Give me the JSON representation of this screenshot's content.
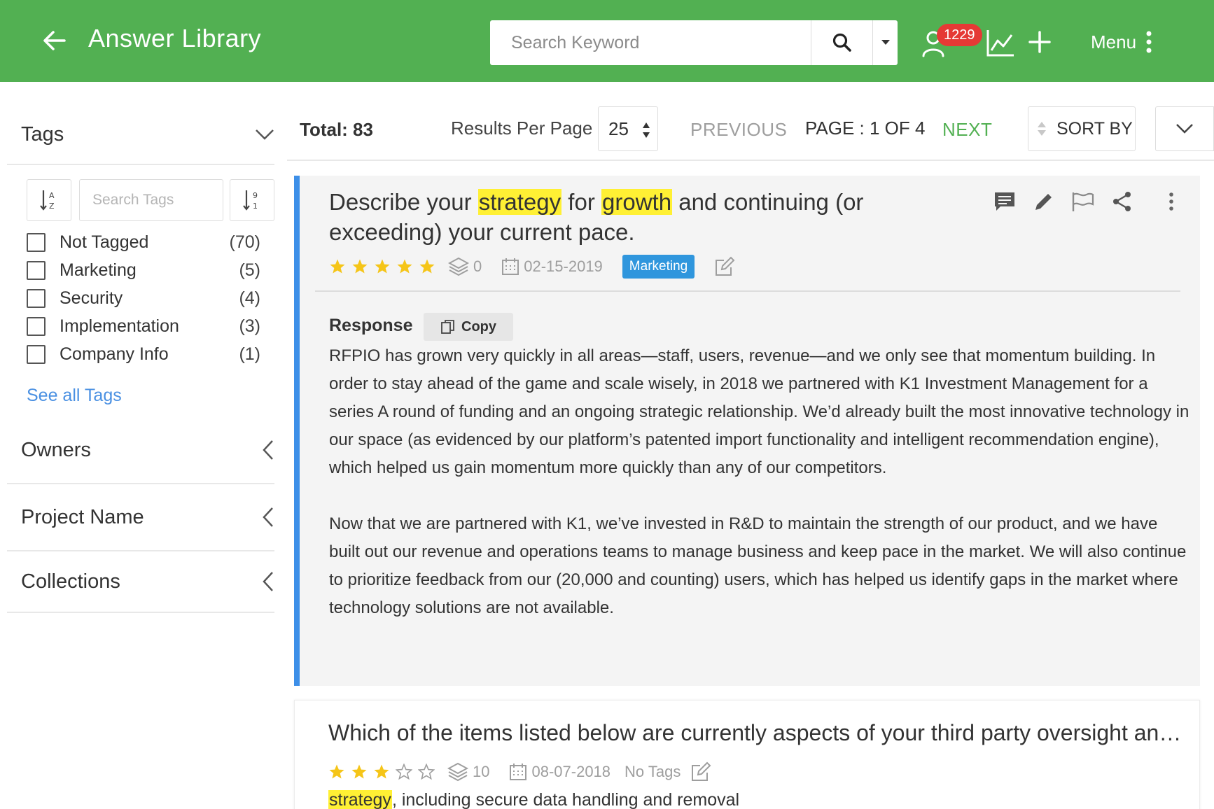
{
  "header": {
    "title": "Answer Library",
    "search_placeholder": "Search Keyword",
    "notification_count": "1229",
    "menu_label": "Menu",
    "bg_color": "#52b052"
  },
  "sidebar": {
    "tags_title": "Tags",
    "tag_search_placeholder": "Search Tags",
    "tags": [
      {
        "name": "Not Tagged",
        "count": "(70)"
      },
      {
        "name": "Marketing",
        "count": "(5)"
      },
      {
        "name": "Security",
        "count": "(4)"
      },
      {
        "name": "Implementation",
        "count": "(3)"
      },
      {
        "name": "Company Info",
        "count": "(1)"
      }
    ],
    "see_all": "See all Tags",
    "sections": [
      "Owners",
      "Project Name",
      "Collections"
    ]
  },
  "toolbar": {
    "total": "Total: 83",
    "results_per_page_label": "Results Per Page",
    "results_per_page": "25",
    "previous": "PREVIOUS",
    "page_info": "PAGE : 1 OF 4",
    "next": "NEXT",
    "sort_by": "SORT BY"
  },
  "results": [
    {
      "title_parts": [
        "Describe your ",
        "strategy",
        " for ",
        "growth",
        " and continuing (or exceeding) your current pace."
      ],
      "rating": 5,
      "usage_count": "0",
      "date": "02-15-2019",
      "tag": "Marketing",
      "response_label": "Response",
      "copy_label": "Copy",
      "response_paragraphs": [
        "RFPIO has grown very quickly in all areas—staff, users, revenue—and we only see that momentum building. In order to stay ahead of the game and scale wisely, in 2018 we partnered with K1 Investment Management for a series A round of funding and an ongoing strategic relationship. We’d already built the most innovative technology in our space (as evidenced by our platform’s patented import functionality and intelligent recommendation engine), which helped us gain momentum more quickly than any of our competitors.",
        "Now that we are partnered with K1, we’ve invested in R&D to maintain the strength of our product, and we have built out our revenue and operations teams to manage business and keep pace in the market. We will also continue to prioritize feedback from our (20,000 and counting) users, which has helped us identify gaps in the market where technology solutions are not available."
      ]
    },
    {
      "title": "Which of the items listed below are currently aspects of your third party oversight and risk management program",
      "rating": 3,
      "usage_count": "10",
      "date": "08-07-2018",
      "tag": "No Tags",
      "snippet_highlight": "strategy",
      "snippet_rest": ", including secure data handling and removal"
    }
  ]
}
